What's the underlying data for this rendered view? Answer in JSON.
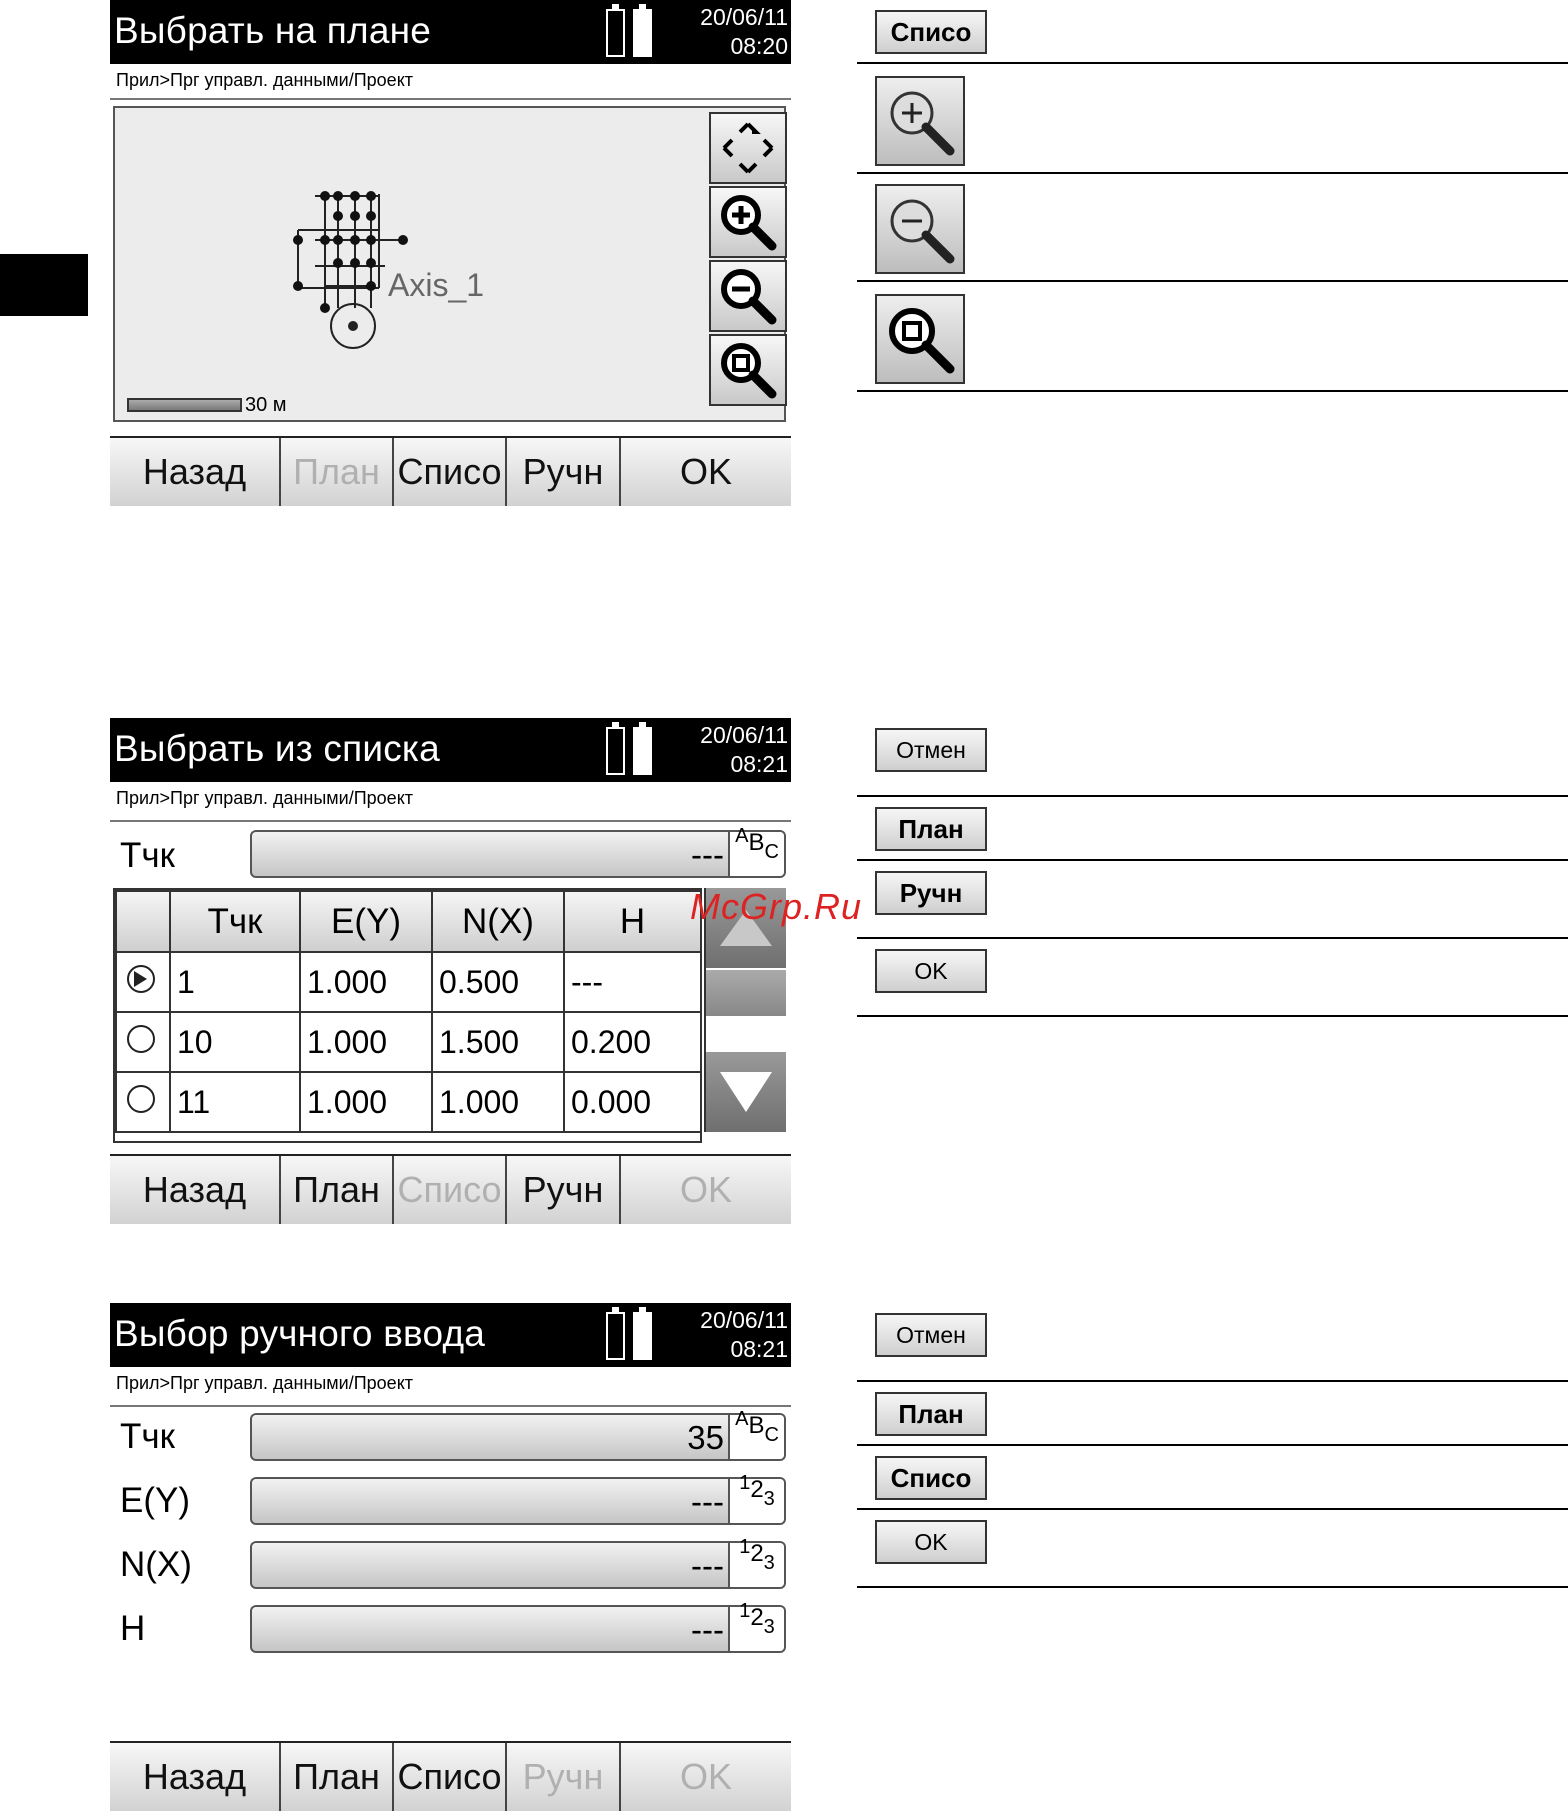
{
  "screens": [
    {
      "title": "Выбрать на плане",
      "date": "20/06/11",
      "time": "08:20",
      "breadcrumb": "Прил>Прг управл. данными/Проект",
      "map": {
        "axis_label": "Axis_1",
        "scale_label": "30 м"
      },
      "softkeys": [
        {
          "label": "Назад",
          "enabled": true
        },
        {
          "label": "План",
          "enabled": false
        },
        {
          "label": "Списо",
          "enabled": true
        },
        {
          "label": "Ручн",
          "enabled": true
        },
        {
          "label": "OK",
          "enabled": true
        }
      ]
    },
    {
      "title": "Выбрать из списка",
      "date": "20/06/11",
      "time": "08:21",
      "breadcrumb": "Прил>Прг управл. данными/Проект",
      "point_field": {
        "label": "Тчк",
        "value": "---",
        "mode": [
          "A",
          "B",
          "C"
        ]
      },
      "table": {
        "headers": [
          "",
          "Тчк",
          "E(Y)",
          "N(X)",
          "H"
        ],
        "rows": [
          {
            "selected": true,
            "point": "1",
            "e": "1.000",
            "n": "0.500",
            "h": "---"
          },
          {
            "selected": false,
            "point": "10",
            "e": "1.000",
            "n": "1.500",
            "h": "0.200"
          },
          {
            "selected": false,
            "point": "11",
            "e": "1.000",
            "n": "1.000",
            "h": "0.000"
          }
        ]
      },
      "softkeys": [
        {
          "label": "Назад",
          "enabled": true
        },
        {
          "label": "План",
          "enabled": true
        },
        {
          "label": "Списо",
          "enabled": false
        },
        {
          "label": "Ручн",
          "enabled": true
        },
        {
          "label": "OK",
          "enabled": false
        }
      ]
    },
    {
      "title": "Выбор ручного ввода",
      "date": "20/06/11",
      "time": "08:21",
      "breadcrumb": "Прил>Прг управл. данными/Проект",
      "fields": [
        {
          "label": "Тчк",
          "value": "35",
          "mode": [
            "A",
            "B",
            "C"
          ]
        },
        {
          "label": "E(Y)",
          "value": "---",
          "mode": [
            "1",
            "2",
            "3"
          ]
        },
        {
          "label": "N(X)",
          "value": "---",
          "mode": [
            "1",
            "2",
            "3"
          ]
        },
        {
          "label": "H",
          "value": "---",
          "mode": [
            "1",
            "2",
            "3"
          ]
        }
      ],
      "softkeys": [
        {
          "label": "Назад",
          "enabled": true
        },
        {
          "label": "План",
          "enabled": true
        },
        {
          "label": "Списо",
          "enabled": true
        },
        {
          "label": "Ручн",
          "enabled": false
        },
        {
          "label": "OK",
          "enabled": false
        }
      ]
    }
  ],
  "legends": [
    {
      "items": [
        {
          "type": "key",
          "label": "Списо"
        },
        {
          "type": "icon",
          "icon": "zoom-in-icon"
        },
        {
          "type": "icon",
          "icon": "zoom-out-icon"
        },
        {
          "type": "icon",
          "icon": "zoom-fit-icon"
        }
      ]
    },
    {
      "items": [
        {
          "type": "key",
          "label": "Отмен"
        },
        {
          "type": "key",
          "label": "План"
        },
        {
          "type": "key",
          "label": "Ручн"
        },
        {
          "type": "key",
          "label": "OK"
        }
      ]
    },
    {
      "items": [
        {
          "type": "key",
          "label": "Отмен"
        },
        {
          "type": "key",
          "label": "План"
        },
        {
          "type": "key",
          "label": "Списо"
        },
        {
          "type": "key",
          "label": "OK"
        }
      ]
    }
  ],
  "watermark": "McGrp.Ru"
}
